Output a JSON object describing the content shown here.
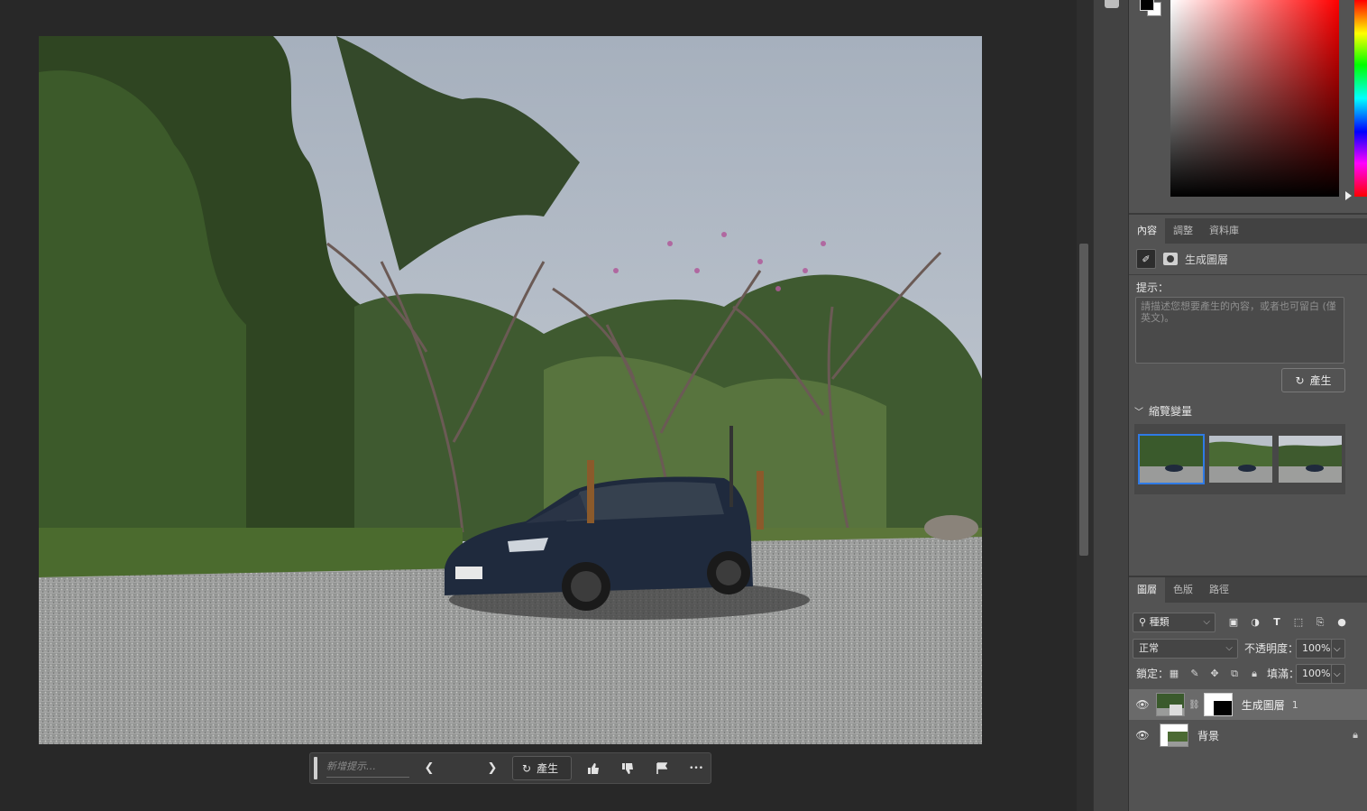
{
  "taskbar": {
    "prompt_placeholder": "新增提示…",
    "prev_icon": "chevron-left-icon",
    "next_icon": "chevron-right-icon",
    "generate_label": "產生",
    "more_label": "•••"
  },
  "properties": {
    "tabs": [
      "內容",
      "調整",
      "資料庫"
    ],
    "active_tab": "內容",
    "layer_type": "生成圖層",
    "prompt_label": "提示：",
    "prompt_placeholder": "請描述您想要產生的內容，或者也可留白 (僅英文)。",
    "generate_label": "產生",
    "variations_title": "縮覽變量",
    "variation_count": 3
  },
  "layers_panel": {
    "tabs": [
      "圖層",
      "色版",
      "路徑"
    ],
    "active_tab": "圖層",
    "filter_value": "種類",
    "blend_mode": "正常",
    "opacity_label": "不透明度：",
    "opacity_value": "100%",
    "lock_label": "鎖定：",
    "fill_label": "填滿：",
    "fill_value": "100%",
    "layers": [
      {
        "name": "生成圖層",
        "badge": "1",
        "selected": true,
        "visible": true
      },
      {
        "name": "背景",
        "selected": false,
        "visible": true,
        "locked": true
      }
    ]
  },
  "colors": {
    "accent": "#2f7ae5",
    "panel_bg": "#535353",
    "canvas_bg": "#282828"
  }
}
